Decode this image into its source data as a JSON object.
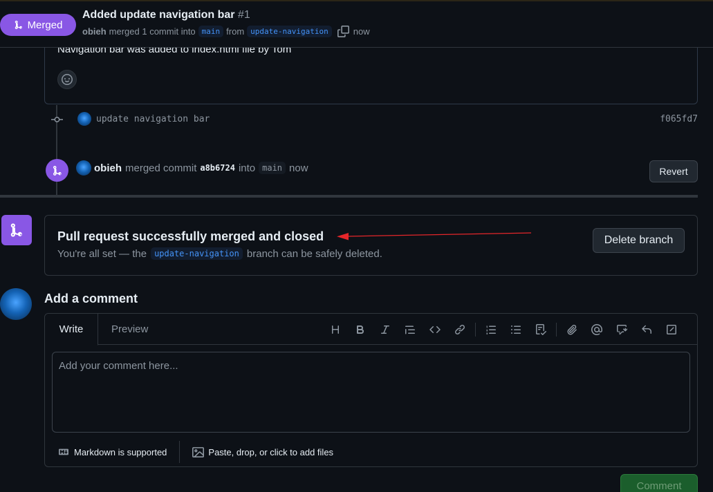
{
  "header": {
    "state_label": "Merged",
    "title": "Added update navigation bar",
    "number": "#1",
    "author": "obieh",
    "merged_text": "merged 1 commit into",
    "base_branch": "main",
    "from_text": "from",
    "head_branch": "update-navigation",
    "time": "now"
  },
  "top_comment": {
    "body": "Navigation bar was added to index.html file by Tom"
  },
  "timeline": {
    "commit_message": "update navigation bar",
    "commit_sha": "f065fd7",
    "merge_event": {
      "author": "obieh",
      "text": "merged commit",
      "sha": "a8b6724",
      "into_text": "into",
      "branch": "main",
      "time": "now"
    },
    "revert_label": "Revert"
  },
  "merge_status": {
    "title": "Pull request successfully merged and closed",
    "sub_prefix": "You're all set — the",
    "branch": "update-navigation",
    "sub_suffix": "branch can be safely deleted.",
    "delete_label": "Delete branch"
  },
  "add_comment": {
    "title": "Add a comment",
    "tabs": [
      "Write",
      "Preview"
    ],
    "placeholder": "Add your comment here...",
    "markdown_note": "Markdown is supported",
    "attach_note": "Paste, drop, or click to add files",
    "submit_label": "Comment"
  },
  "colors": {
    "merged_purple": "#8957e5",
    "annotation_red": "#e5262a",
    "submit_green": "#1b5e2c"
  },
  "icons": {
    "merge": "git-merge-icon",
    "copy": "copy-icon",
    "smiley": "smiley-icon",
    "commit": "git-commit-icon"
  }
}
